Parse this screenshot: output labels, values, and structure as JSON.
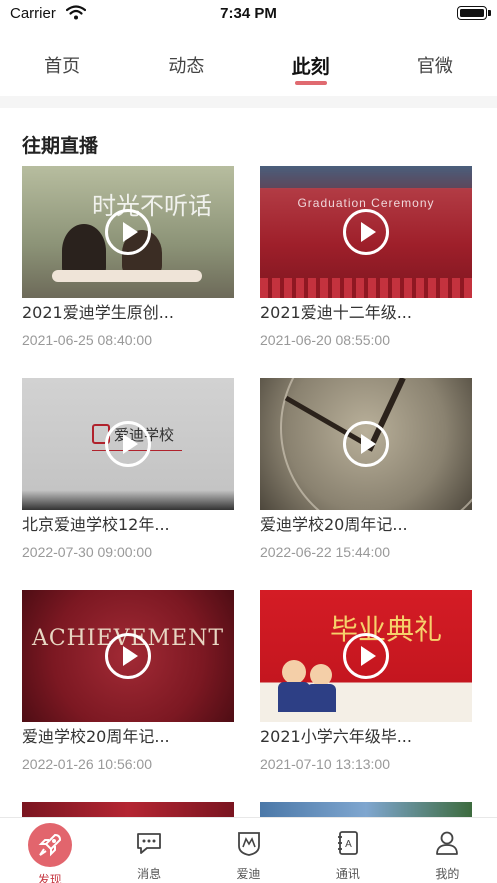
{
  "status_bar": {
    "carrier": "Carrier",
    "time": "7:34 PM"
  },
  "top_tabs": [
    {
      "label": "首页",
      "active": false
    },
    {
      "label": "动态",
      "active": false
    },
    {
      "label": "此刻",
      "active": true
    },
    {
      "label": "官微",
      "active": false
    }
  ],
  "section": {
    "title": "往期直播"
  },
  "videos": [
    {
      "title": "2021爱迪学生原创...",
      "date": "2021-06-25 08:40:00",
      "thumb_text": "时光不听话",
      "thumb_color": "#9aa07f"
    },
    {
      "title": "2021爱迪十二年级...",
      "date": "2021-06-20 08:55:00",
      "thumb_text": "Graduation Ceremony",
      "thumb_color": "#9e1f2a"
    },
    {
      "title": "北京爱迪学校12年...",
      "date": "2022-07-30 09:00:00",
      "thumb_text": "爱迪学校",
      "thumb_color": "#cfcfcf"
    },
    {
      "title": "爱迪学校20周年记...",
      "date": "2022-06-22 15:44:00",
      "thumb_text": "",
      "thumb_color": "#8a8270"
    },
    {
      "title": "爱迪学校20周年记...",
      "date": "2022-01-26 10:56:00",
      "thumb_text": "ACHIEVEMENT",
      "thumb_color": "#7c1822"
    },
    {
      "title": "2021小学六年级毕...",
      "date": "2021-07-10 13:13:00",
      "thumb_text": "毕业典礼",
      "thumb_color": "#c4161f"
    }
  ],
  "bottom_nav": [
    {
      "label": "发现",
      "icon": "rocket-icon",
      "active": true
    },
    {
      "label": "消息",
      "icon": "chat-bubble-icon",
      "active": false
    },
    {
      "label": "爱迪",
      "icon": "school-logo-icon",
      "active": false
    },
    {
      "label": "通讯",
      "icon": "contacts-book-icon",
      "active": false
    },
    {
      "label": "我的",
      "icon": "person-icon",
      "active": false
    }
  ],
  "colors": {
    "accent": "#e06a70",
    "active_label": "#c73a44"
  }
}
